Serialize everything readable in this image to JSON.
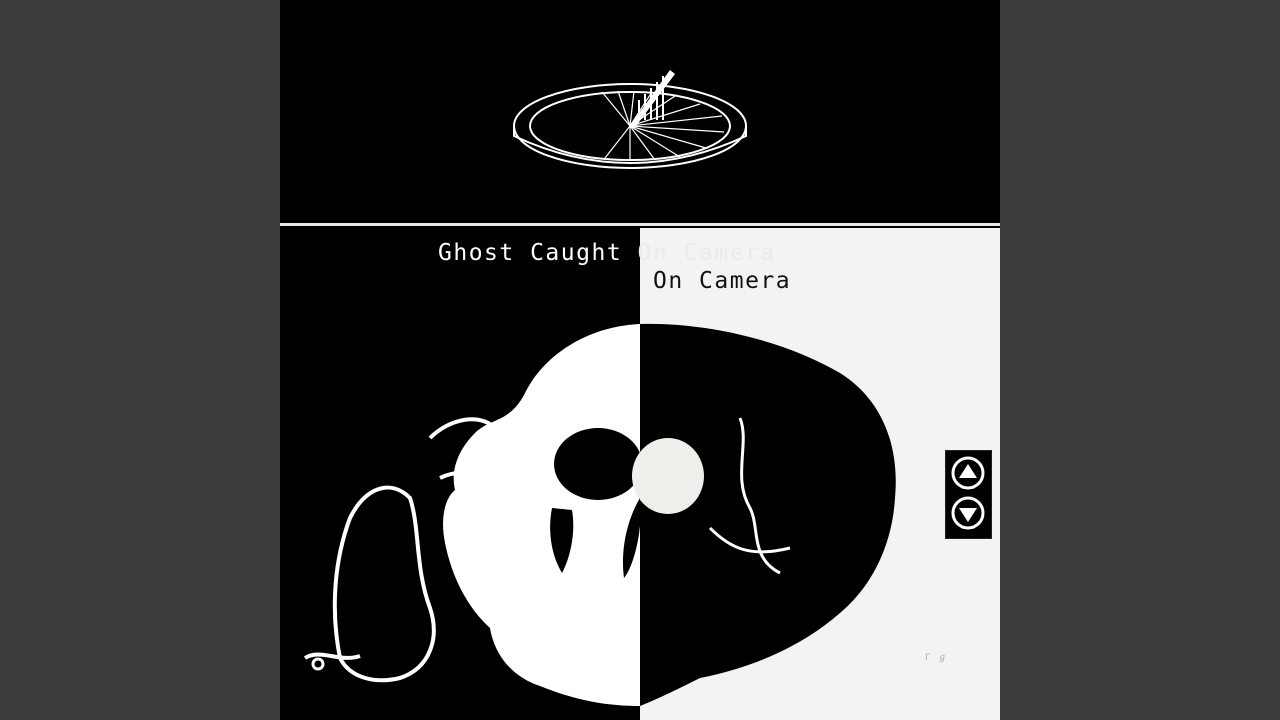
{
  "cover": {
    "title_line1_a": "Ghost Caught",
    "title_line1_b": "On Camera",
    "title_line2": "On Camera",
    "watermark": "Γ ℊ"
  },
  "icons": {
    "sundial": "sundial-icon",
    "skull": "skull-illustration",
    "scroll_up": "scroll-up-icon",
    "scroll_down": "scroll-down-icon"
  },
  "colors": {
    "background": "#3d3d3d",
    "black": "#000000",
    "white": "#f3f4f2"
  }
}
